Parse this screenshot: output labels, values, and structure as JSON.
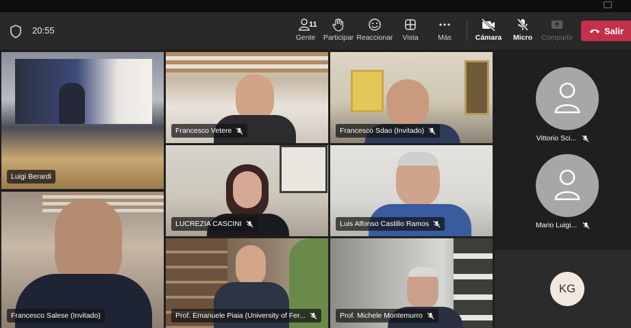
{
  "status": {
    "time": "20:55"
  },
  "toolbar": {
    "people_count": "11",
    "people_label": "Gente",
    "raise_label": "Participar",
    "react_label": "Reaccionar",
    "view_label": "Vista",
    "more_label": "Más",
    "camera_label": "Cámara",
    "mic_label": "Micro",
    "share_label": "Compartir",
    "leave_label": "Salir"
  },
  "grid": {
    "tiles": [
      {
        "name": "Luigi Berardi",
        "muted": false
      },
      {
        "name": "Francesco Vetere",
        "muted": true
      },
      {
        "name": "Francesco Sdao (Invitado)",
        "muted": true
      },
      {
        "name": "LUCREZIA CASCINI",
        "muted": true
      },
      {
        "name": "Luis Alfonso Castillo Ramos",
        "muted": true
      },
      {
        "name": "Francesco Salese (Invitado)",
        "muted": false
      },
      {
        "name": "Prof. Emanuele Piaia (University of Fer...",
        "muted": true
      },
      {
        "name": "Prof. Michele Montemurro",
        "muted": true
      }
    ]
  },
  "sidebar": {
    "participants": [
      {
        "name": "Vittorio Sci...",
        "muted": true
      },
      {
        "name": "Mario Luigi...",
        "muted": true
      }
    ],
    "initials": "KG"
  },
  "colors": {
    "leave": "#c4314b",
    "selected": "#7b83eb",
    "toolbar": "#292929"
  }
}
